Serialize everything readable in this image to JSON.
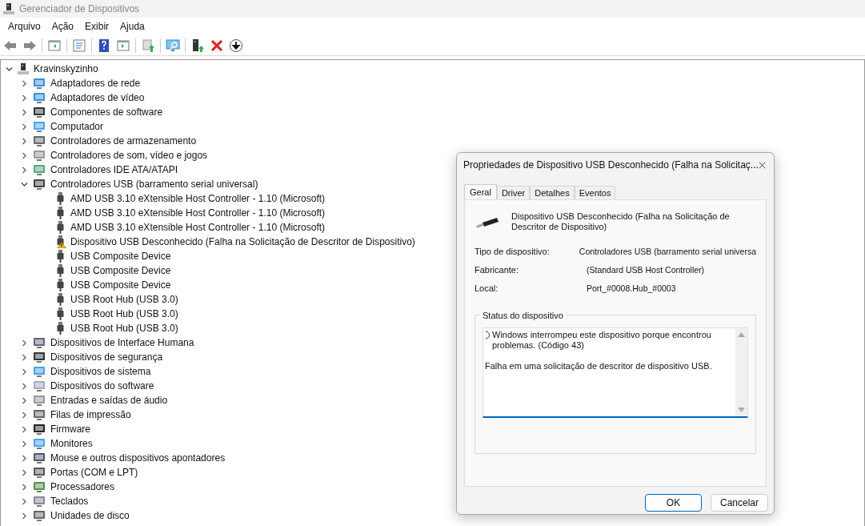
{
  "window": {
    "title": "Gerenciador de Dispositivos"
  },
  "menu": [
    "Arquivo",
    "Ação",
    "Exibir",
    "Ajuda"
  ],
  "tree": {
    "label": "Kravinskyzinho",
    "expanded": true,
    "children": [
      {
        "label": "Adaptadores de rede",
        "expanded": false
      },
      {
        "label": "Adaptadores de vídeo",
        "expanded": false
      },
      {
        "label": "Componentes de software",
        "expanded": false
      },
      {
        "label": "Computador",
        "expanded": false
      },
      {
        "label": "Controladores de armazenamento",
        "expanded": false
      },
      {
        "label": "Controladores de som, vídeo e jogos",
        "expanded": false
      },
      {
        "label": "Controladores IDE ATA/ATAPI",
        "expanded": false
      },
      {
        "label": "Controladores USB (barramento serial universal)",
        "expanded": true,
        "children": [
          {
            "label": "AMD USB 3.10 eXtensible Host Controller - 1.10 (Microsoft)",
            "warning": false
          },
          {
            "label": "AMD USB 3.10 eXtensible Host Controller - 1.10 (Microsoft)",
            "warning": false
          },
          {
            "label": "AMD USB 3.10 eXtensible Host Controller - 1.10 (Microsoft)",
            "warning": false
          },
          {
            "label": "Dispositivo USB Desconhecido (Falha na Solicitação de Descritor de Dispositivo)",
            "warning": true
          },
          {
            "label": "USB Composite Device",
            "warning": false
          },
          {
            "label": "USB Composite Device",
            "warning": false
          },
          {
            "label": "USB Composite Device",
            "warning": false
          },
          {
            "label": "USB Root Hub (USB 3.0)",
            "warning": false
          },
          {
            "label": "USB Root Hub (USB 3.0)",
            "warning": false
          },
          {
            "label": "USB Root Hub (USB 3.0)",
            "warning": false
          }
        ]
      },
      {
        "label": "Dispositivos de Interface Humana",
        "expanded": false
      },
      {
        "label": "Dispositivos de segurança",
        "expanded": false
      },
      {
        "label": "Dispositivos de sistema",
        "expanded": false
      },
      {
        "label": "Dispositivos do software",
        "expanded": false
      },
      {
        "label": "Entradas e saídas de áudio",
        "expanded": false
      },
      {
        "label": "Filas de impressão",
        "expanded": false
      },
      {
        "label": "Firmware",
        "expanded": false
      },
      {
        "label": "Monitores",
        "expanded": false
      },
      {
        "label": "Mouse e outros dispositivos apontadores",
        "expanded": false
      },
      {
        "label": "Portas (COM e LPT)",
        "expanded": false
      },
      {
        "label": "Processadores",
        "expanded": false
      },
      {
        "label": "Teclados",
        "expanded": false
      },
      {
        "label": "Unidades de disco",
        "expanded": false
      }
    ]
  },
  "dialog": {
    "title": "Propriedades de Dispositivo USB Desconhecido (Falha na Solicitaç...",
    "tabs": [
      {
        "label": "Geral",
        "selected": true
      },
      {
        "label": "Driver",
        "selected": false
      },
      {
        "label": "Detalhes",
        "selected": false
      },
      {
        "label": "Eventos",
        "selected": false
      }
    ],
    "device_name": "Dispositivo USB Desconhecido (Falha na Solicitação de Descritor de Dispositivo)",
    "properties": [
      {
        "label": "Tipo de dispositivo:",
        "value": "Controladores USB (barramento serial universa"
      },
      {
        "label": "Fabricante:",
        "value": "(Standard USB Host Controller)"
      },
      {
        "label": "Local:",
        "value": "Port_#0008.Hub_#0003"
      }
    ],
    "status_group": "Status do dispositivo",
    "status_text": [
      "Windows interrompeu este dispositivo porque encontrou problemas. (Código 43)",
      "Falha em uma solicitação de descritor de dispositivo USB."
    ],
    "buttons": [
      {
        "label": "OK",
        "default": true
      },
      {
        "label": "Cancelar",
        "default": false
      }
    ]
  }
}
